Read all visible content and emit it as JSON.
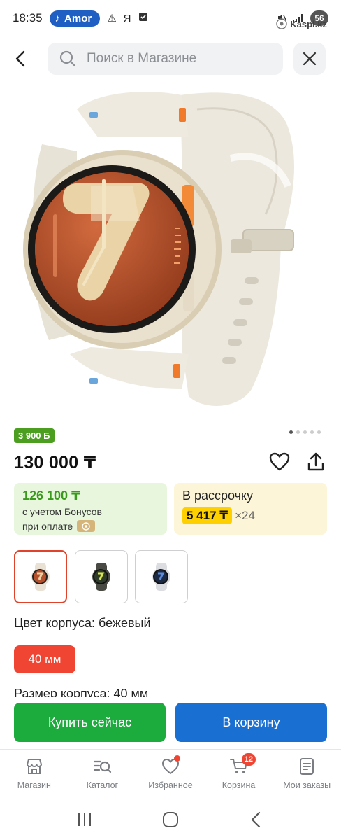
{
  "status_bar": {
    "time": "18:35",
    "music_label": "Amor",
    "carrier_icon": "Я",
    "battery": "56",
    "watermark": "Kaspi.kz"
  },
  "header": {
    "search_placeholder": "Поиск в Магазине"
  },
  "product": {
    "bonus_badge": "3 900 Б",
    "price": "130 000 ₸",
    "bonus_price": {
      "amount": "126 100 ₸",
      "line1": "с учетом Бонусов",
      "line2": "при оплате"
    },
    "credit": {
      "title": "В рассрочку",
      "monthly": "5 417 ₸",
      "months": "×24"
    },
    "variants": [
      {
        "name": "beige",
        "case_color": "#e9e1d3",
        "dial_color": "#b4502c"
      },
      {
        "name": "graphite",
        "case_color": "#4a4a44",
        "dial_color": "#d8e84a"
      },
      {
        "name": "silver",
        "case_color": "#dcdde0",
        "dial_color": "#2a4fa8"
      }
    ],
    "color_label": "Цвет корпуса: бежевый",
    "size_chip": "40 мм",
    "size_label": "Размер корпуса: 40 мм"
  },
  "actions": {
    "buy_now": "Купить сейчас",
    "add_to_cart": "В корзину"
  },
  "bottom_nav": {
    "items": [
      {
        "label": "Магазин",
        "icon": "store-icon"
      },
      {
        "label": "Каталог",
        "icon": "catalog-search-icon"
      },
      {
        "label": "Избранное",
        "icon": "heart-icon"
      },
      {
        "label": "Корзина",
        "icon": "cart-icon"
      },
      {
        "label": "Мои заказы",
        "icon": "orders-icon"
      }
    ],
    "cart_count": "12"
  },
  "colors": {
    "accent_blue": "#1a6fd2",
    "accent_green": "#1cab3d",
    "accent_red": "#ef4532",
    "bonus_green": "#4b9e1f"
  }
}
